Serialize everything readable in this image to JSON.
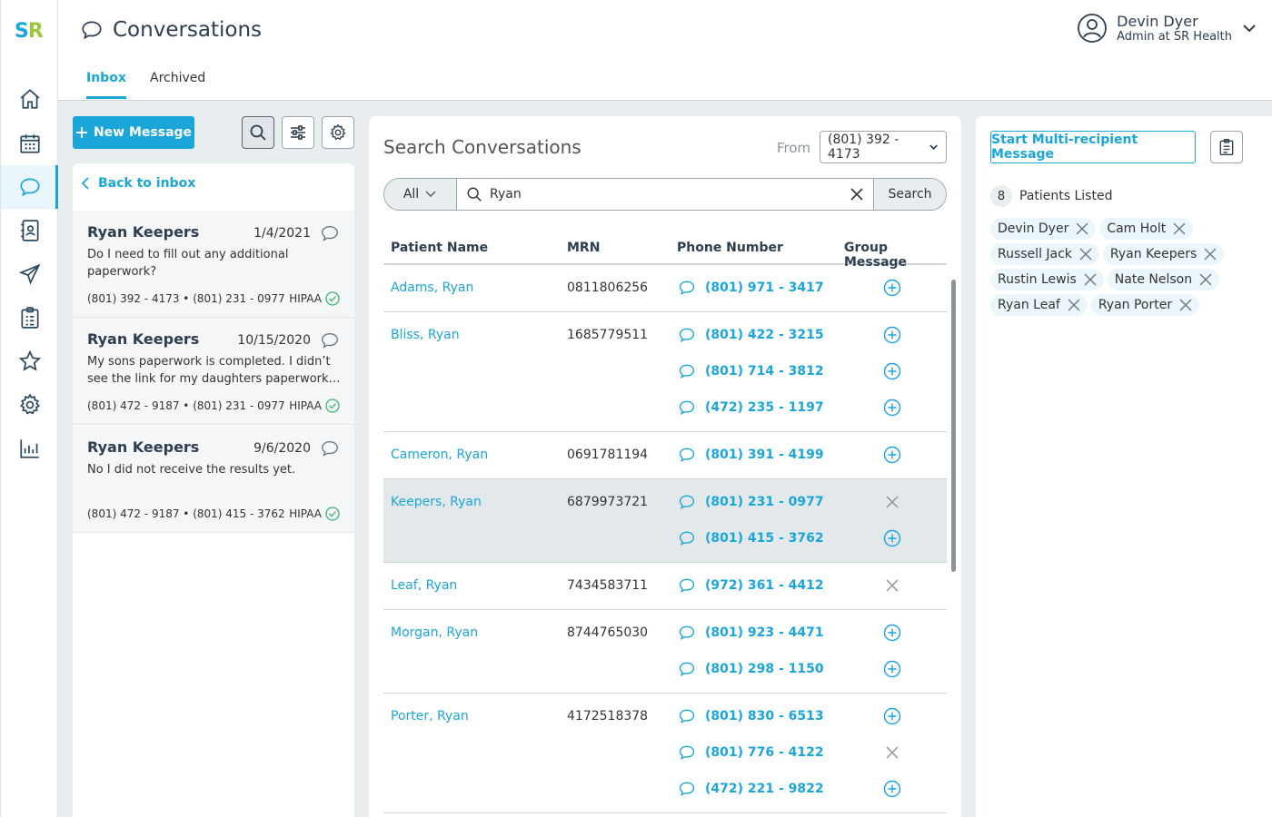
{
  "app": {
    "logo_s": "S",
    "logo_r": "R",
    "page_title": "Conversations"
  },
  "nav": {
    "items": [
      {
        "name": "home-icon"
      },
      {
        "name": "calendar-icon"
      },
      {
        "name": "chat-icon",
        "active": true
      },
      {
        "name": "contacts-icon"
      },
      {
        "name": "send-icon"
      },
      {
        "name": "clipboard-icon"
      },
      {
        "name": "star-icon"
      },
      {
        "name": "gear-icon"
      },
      {
        "name": "chart-icon"
      }
    ]
  },
  "header": {
    "tabs": [
      "Inbox",
      "Archived"
    ],
    "active_tab": "Inbox",
    "user": {
      "name": "Devin Dyer",
      "role": "Admin at SR Health"
    }
  },
  "toolbar": {
    "new_message_label": "New Message"
  },
  "inbox": {
    "back_label": "Back to inbox",
    "conversations": [
      {
        "name": "Ryan Keepers",
        "date": "1/4/2021",
        "text": "Do I need to fill out any additional paperwork?",
        "from": "(801) 392 - 4173",
        "to": "(801) 231 - 0977",
        "badge": "HIPAA"
      },
      {
        "name": "Ryan Keepers",
        "date": "10/15/2020",
        "text": "My sons paperwork is completed. I didn’t see the link for my daughters paperwork…",
        "from": "(801) 472 - 9187",
        "to": "(801) 231 - 0977",
        "badge": "HIPAA"
      },
      {
        "name": "Ryan Keepers",
        "date": "9/6/2020",
        "text": "No I did not receive the results yet.",
        "from": "(801) 472 - 9187",
        "to": "(801) 415 - 3762",
        "badge": "HIPAA"
      }
    ]
  },
  "search": {
    "title": "Search Conversations",
    "from_label": "From",
    "from_value": "(801) 392 - 4173",
    "filter": "All",
    "query": "Ryan",
    "button": "Search"
  },
  "table": {
    "headers": [
      "Patient Name",
      "MRN",
      "Phone Number",
      "Group Message"
    ],
    "rows": [
      {
        "name": "Adams, Ryan",
        "mrn": "0811806256",
        "phones": [
          {
            "num": "(801) 971 - 3417",
            "added": false
          }
        ]
      },
      {
        "name": "Bliss, Ryan",
        "mrn": "1685779511",
        "phones": [
          {
            "num": "(801) 422 - 3215",
            "added": false
          },
          {
            "num": "(801) 714 - 3812",
            "added": false
          },
          {
            "num": "(472) 235 - 1197",
            "added": false
          }
        ]
      },
      {
        "name": "Cameron, Ryan",
        "mrn": "0691781194",
        "phones": [
          {
            "num": "(801) 391 - 4199",
            "added": false
          }
        ]
      },
      {
        "name": "Keepers, Ryan",
        "mrn": "6879973721",
        "selected": true,
        "phones": [
          {
            "num": "(801) 231 - 0977",
            "added": true
          },
          {
            "num": "(801) 415 - 3762",
            "added": false
          }
        ]
      },
      {
        "name": "Leaf, Ryan",
        "mrn": "7434583711",
        "phones": [
          {
            "num": "(972) 361 - 4412",
            "added": true
          }
        ]
      },
      {
        "name": "Morgan, Ryan",
        "mrn": "8744765030",
        "phones": [
          {
            "num": "(801) 923 - 4471",
            "added": false
          },
          {
            "num": "(801) 298 - 1150",
            "added": false
          }
        ]
      },
      {
        "name": "Porter, Ryan",
        "mrn": "4172518378",
        "phones": [
          {
            "num": "(801) 830 - 6513",
            "added": false
          },
          {
            "num": "(801) 776 - 4122",
            "added": true
          },
          {
            "num": "(472) 221 - 9822",
            "added": false
          }
        ]
      }
    ]
  },
  "recipients": {
    "button_label": "Start Multi-recipient Message",
    "count": "8",
    "count_label": "Patients Listed",
    "chips": [
      "Devin Dyer",
      "Cam Holt",
      "Russell Jack",
      "Ryan Keepers",
      "Rustin Lewis",
      "Nate Nelson",
      "Ryan Leaf",
      "Ryan Porter"
    ]
  },
  "colors": {
    "accent": "#1ba6d9",
    "success": "#3cb371",
    "background": "#e8edf0"
  }
}
